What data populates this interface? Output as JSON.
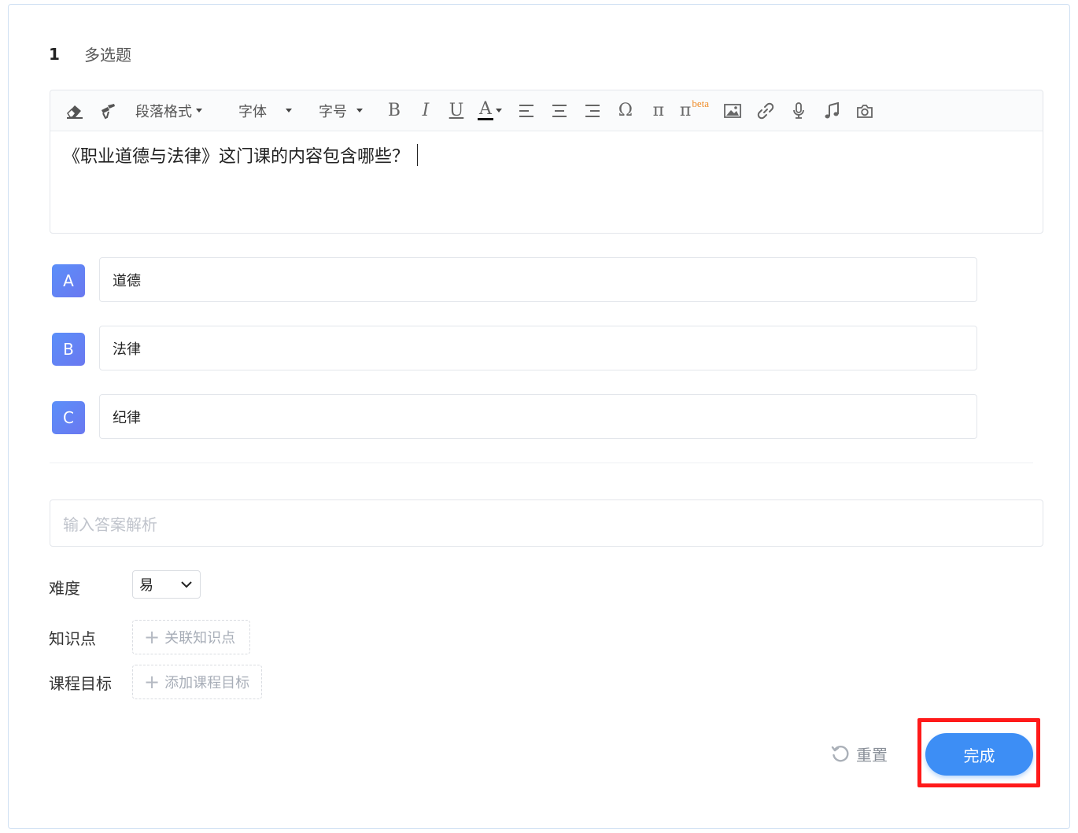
{
  "question": {
    "number": "1",
    "type": "多选题"
  },
  "toolbar": {
    "paragraph_format": "段落格式",
    "font": "字体",
    "font_size": "字号",
    "bold": "B",
    "italic": "I",
    "underline": "U",
    "font_color": "A",
    "omega": "Ω",
    "pi": "π",
    "pi_beta": "π",
    "beta_label": "beta"
  },
  "editor": {
    "content": "《职业道德与法律》这门课的内容包含哪些？"
  },
  "options": [
    {
      "letter": "A",
      "text": "道德"
    },
    {
      "letter": "B",
      "text": "法律"
    },
    {
      "letter": "C",
      "text": "纪律"
    }
  ],
  "analysis": {
    "placeholder": "输入答案解析"
  },
  "difficulty": {
    "label": "难度",
    "value": "易"
  },
  "knowledge": {
    "label": "知识点",
    "button": "关联知识点"
  },
  "course_goal": {
    "label": "课程目标",
    "button": "添加课程目标"
  },
  "actions": {
    "reset": "重置",
    "done": "完成"
  },
  "colors": {
    "primary": "#3d8ef5",
    "badge": "#5b8ff9",
    "highlight": "#ff1a1a",
    "beta": "#f08c28"
  }
}
